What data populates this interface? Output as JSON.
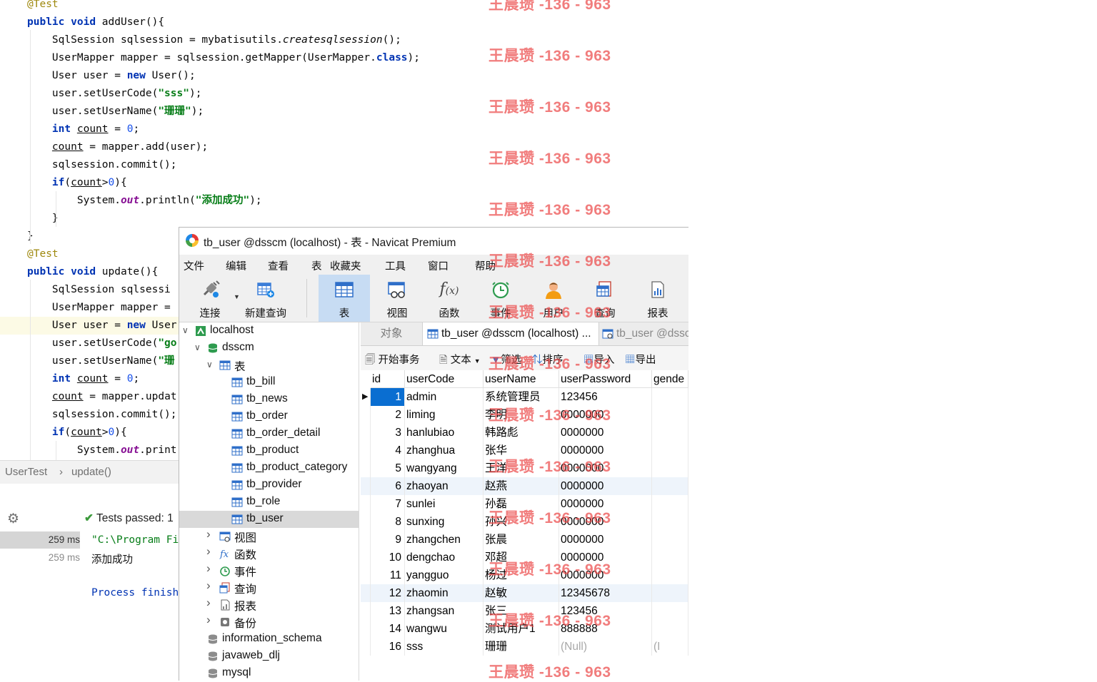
{
  "ide": {
    "code_lines": [
      [
        {
          "t": "@Test",
          "c": "a"
        }
      ],
      [
        {
          "t": "public",
          "c": "k"
        },
        {
          "t": " "
        },
        {
          "t": "void",
          "c": "k"
        },
        {
          "t": " addUser(){"
        }
      ],
      [
        {
          "t": "    SqlSession sqlsession = mybatisutils."
        },
        {
          "t": "createsqlsession",
          "c": "it"
        },
        {
          "t": "();"
        }
      ],
      [
        {
          "t": "    UserMapper mapper = sqlsession.getMapper(UserMapper."
        },
        {
          "t": "class",
          "c": "k"
        },
        {
          "t": ");"
        }
      ],
      [
        {
          "t": "    User user = "
        },
        {
          "t": "new",
          "c": "k"
        },
        {
          "t": " User();"
        }
      ],
      [
        {
          "t": "    user.setUserCode("
        },
        {
          "t": "\"sss\"",
          "c": "s"
        },
        {
          "t": ");"
        }
      ],
      [
        {
          "t": "    user.setUserName("
        },
        {
          "t": "\"珊珊\"",
          "c": "s"
        },
        {
          "t": ");"
        }
      ],
      [
        {
          "t": "    "
        },
        {
          "t": "int",
          "c": "k"
        },
        {
          "t": " "
        },
        {
          "t": "count",
          "c": "u"
        },
        {
          "t": " = "
        },
        {
          "t": "0",
          "c": "n"
        },
        {
          "t": ";"
        }
      ],
      [
        {
          "t": "    "
        },
        {
          "t": "count",
          "c": "u"
        },
        {
          "t": " = mapper.add(user);"
        }
      ],
      [
        {
          "t": "    sqlsession.commit();"
        }
      ],
      [
        {
          "t": "    "
        },
        {
          "t": "if",
          "c": "k"
        },
        {
          "t": "("
        },
        {
          "t": "count",
          "c": "u"
        },
        {
          "t": ">"
        },
        {
          "t": "0",
          "c": "n"
        },
        {
          "t": "){"
        }
      ],
      [
        {
          "t": "        System."
        },
        {
          "t": "out",
          "c": "fld"
        },
        {
          "t": ".println("
        },
        {
          "t": "\"添加成功\"",
          "c": "s"
        },
        {
          "t": ");"
        }
      ],
      [
        {
          "t": "    }"
        }
      ],
      [
        {
          "t": "}"
        }
      ],
      [
        {
          "t": "@Test",
          "c": "a"
        }
      ],
      [
        {
          "t": "public",
          "c": "k"
        },
        {
          "t": " "
        },
        {
          "t": "void",
          "c": "k"
        },
        {
          "t": " update(){"
        }
      ],
      [
        {
          "t": "    SqlSession sqlsessi"
        }
      ],
      [
        {
          "t": "    UserMapper mapper = "
        }
      ],
      [
        {
          "t": "    User user = "
        },
        {
          "t": "new",
          "c": "k"
        },
        {
          "t": " User"
        }
      ],
      [
        {
          "t": "    user.setUserCode("
        },
        {
          "t": "\"go",
          "c": "s"
        }
      ],
      [
        {
          "t": "    user.setUserName("
        },
        {
          "t": "\"珊",
          "c": "s"
        }
      ],
      [
        {
          "t": "    "
        },
        {
          "t": "int",
          "c": "k"
        },
        {
          "t": " "
        },
        {
          "t": "count",
          "c": "u"
        },
        {
          "t": " = "
        },
        {
          "t": "0",
          "c": "n"
        },
        {
          "t": ";"
        }
      ],
      [
        {
          "t": "    "
        },
        {
          "t": "count",
          "c": "u"
        },
        {
          "t": " = mapper.updat"
        }
      ],
      [
        {
          "t": "    sqlsession.commit();"
        }
      ],
      [
        {
          "t": "    "
        },
        {
          "t": "if",
          "c": "k"
        },
        {
          "t": "("
        },
        {
          "t": "count",
          "c": "u"
        },
        {
          "t": ">"
        },
        {
          "t": "0",
          "c": "n"
        },
        {
          "t": "){"
        }
      ],
      [
        {
          "t": "        System."
        },
        {
          "t": "out",
          "c": "fld"
        },
        {
          "t": ".print"
        }
      ]
    ],
    "breadcrumb": {
      "class_name": "UserTest",
      "separator": "›",
      "method_name": "update()"
    },
    "run": {
      "tests_passed": "Tests passed: 1",
      "times": [
        "259 ms",
        "259 ms"
      ],
      "output": [
        "\"C:\\Program Fi",
        "添加成功",
        "",
        "Process finish"
      ]
    }
  },
  "watermark": "王晨瓒 -136 - 963",
  "navicat": {
    "title": "tb_user @dsscm (localhost) - 表 - Navicat Premium",
    "menu": [
      "文件",
      "编辑",
      "查看",
      "表",
      "收藏夹",
      "工具",
      "窗口",
      "帮助"
    ],
    "toolbar": [
      "连接",
      "新建查询",
      "表",
      "视图",
      "函数",
      "事件",
      "用户",
      "查询",
      "报表"
    ],
    "tree": {
      "connection": "localhost",
      "database": "dsscm",
      "tables_folder": "表",
      "tables": [
        "tb_bill",
        "tb_news",
        "tb_order",
        "tb_order_detail",
        "tb_product",
        "tb_product_category",
        "tb_provider",
        "tb_role",
        "tb_user"
      ],
      "folders": [
        "视图",
        "函数",
        "事件",
        "查询",
        "报表",
        "备份"
      ],
      "other_dbs": [
        "information_schema",
        "javaweb_dlj",
        "mysql"
      ]
    },
    "tabs": [
      "对象",
      "tb_user @dsscm (localhost) ...",
      "tb_user @dssc"
    ],
    "subtoolbar": [
      "开始事务",
      "文本",
      "筛选",
      "排序",
      "导入",
      "导出"
    ],
    "columns": [
      "id",
      "userCode",
      "userName",
      "userPassword",
      "gende"
    ],
    "rows": [
      {
        "id": "1",
        "userCode": "admin",
        "userName": "系统管理员",
        "userPassword": "123456",
        "gender": ""
      },
      {
        "id": "2",
        "userCode": "liming",
        "userName": "李明",
        "userPassword": "0000000",
        "gender": ""
      },
      {
        "id": "3",
        "userCode": "hanlubiao",
        "userName": "韩路彪",
        "userPassword": "0000000",
        "gender": ""
      },
      {
        "id": "4",
        "userCode": "zhanghua",
        "userName": "张华",
        "userPassword": "0000000",
        "gender": ""
      },
      {
        "id": "5",
        "userCode": "wangyang",
        "userName": "王洋",
        "userPassword": "0000000",
        "gender": ""
      },
      {
        "id": "6",
        "userCode": "zhaoyan",
        "userName": "赵燕",
        "userPassword": "0000000",
        "gender": ""
      },
      {
        "id": "7",
        "userCode": "sunlei",
        "userName": "孙磊",
        "userPassword": "0000000",
        "gender": ""
      },
      {
        "id": "8",
        "userCode": "sunxing",
        "userName": "孙兴",
        "userPassword": "0000000",
        "gender": ""
      },
      {
        "id": "9",
        "userCode": "zhangchen",
        "userName": "张晨",
        "userPassword": "0000000",
        "gender": ""
      },
      {
        "id": "10",
        "userCode": "dengchao",
        "userName": "邓超",
        "userPassword": "0000000",
        "gender": ""
      },
      {
        "id": "11",
        "userCode": "yangguo",
        "userName": "杨过",
        "userPassword": "0000000",
        "gender": ""
      },
      {
        "id": "12",
        "userCode": "zhaomin",
        "userName": "赵敏",
        "userPassword": "12345678",
        "gender": ""
      },
      {
        "id": "13",
        "userCode": "zhangsan",
        "userName": "张三",
        "userPassword": "123456",
        "gender": ""
      },
      {
        "id": "14",
        "userCode": "wangwu",
        "userName": "测试用户1",
        "userPassword": "888888",
        "gender": ""
      },
      {
        "id": "16",
        "userCode": "sss",
        "userName": "珊珊",
        "userPassword": "(Null)",
        "gender": "(I"
      }
    ],
    "colors": {
      "selected_row_bg": "#0a6ed1",
      "active_tool_bg": "#c7dcf3",
      "alt_row_bg": "#eef4fb"
    }
  }
}
